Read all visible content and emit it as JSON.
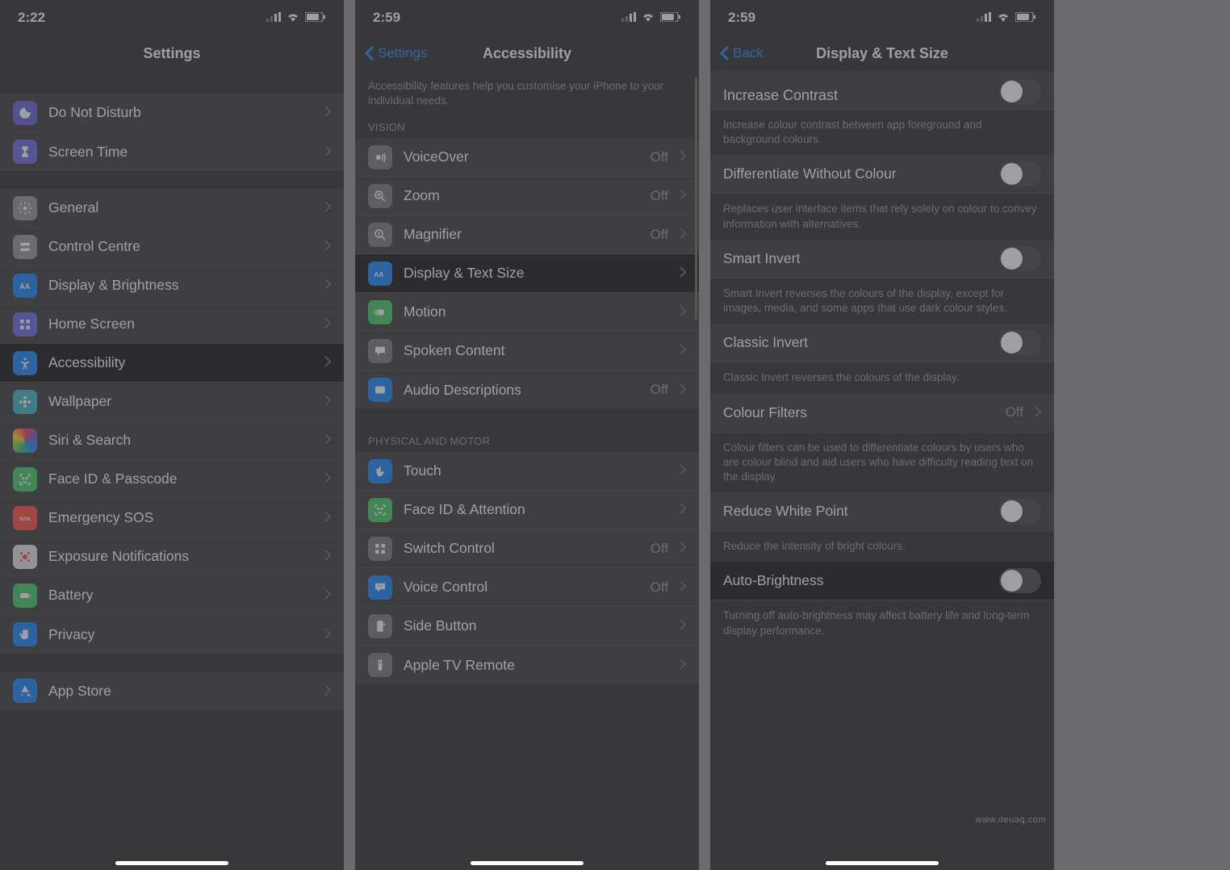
{
  "screen1": {
    "time": "2:22",
    "title": "Settings",
    "rows_group1": [
      {
        "id": "dnd",
        "label": "Do Not Disturb",
        "icon": "moon",
        "color": "ic-purple"
      },
      {
        "id": "screentime",
        "label": "Screen Time",
        "icon": "hourglass",
        "color": "ic-indigo"
      }
    ],
    "rows_group2": [
      {
        "id": "general",
        "label": "General",
        "icon": "gear",
        "color": "ic-gray"
      },
      {
        "id": "controlcentre",
        "label": "Control Centre",
        "icon": "switches",
        "color": "ic-gray"
      },
      {
        "id": "display",
        "label": "Display & Brightness",
        "icon": "textsize",
        "color": "ic-blue"
      },
      {
        "id": "homescreen",
        "label": "Home Screen",
        "icon": "grid",
        "color": "ic-indigo"
      },
      {
        "id": "accessibility",
        "label": "Accessibility",
        "icon": "accessibility",
        "color": "ic-blue",
        "highlight": true
      },
      {
        "id": "wallpaper",
        "label": "Wallpaper",
        "icon": "flower",
        "color": "ic-teal"
      },
      {
        "id": "siri",
        "label": "Siri & Search",
        "icon": "siri",
        "color": "gradient-siri"
      },
      {
        "id": "faceid",
        "label": "Face ID & Passcode",
        "icon": "faceid",
        "color": "ic-green"
      },
      {
        "id": "sos",
        "label": "Emergency SOS",
        "icon": "sos",
        "color": "ic-red"
      },
      {
        "id": "exposure",
        "label": "Exposure Notifications",
        "icon": "exposure",
        "color": "ic-white"
      },
      {
        "id": "battery",
        "label": "Battery",
        "icon": "battery",
        "color": "ic-green"
      },
      {
        "id": "privacy",
        "label": "Privacy",
        "icon": "hand",
        "color": "ic-blue"
      }
    ],
    "rows_group3": [
      {
        "id": "appstore",
        "label": "App Store",
        "icon": "appstore",
        "color": "ic-blue"
      }
    ]
  },
  "screen2": {
    "time": "2:59",
    "back": "Settings",
    "title": "Accessibility",
    "intro": "Accessibility features help you customise your iPhone to your individual needs.",
    "vision_header": "VISION",
    "vision_rows": [
      {
        "id": "voiceover",
        "label": "VoiceOver",
        "value": "Off",
        "icon": "voiceover",
        "color": "ic-dim"
      },
      {
        "id": "zoom",
        "label": "Zoom",
        "value": "Off",
        "icon": "zoom",
        "color": "ic-dim"
      },
      {
        "id": "magnifier",
        "label": "Magnifier",
        "value": "Off",
        "icon": "magnifier",
        "color": "ic-dim"
      },
      {
        "id": "textsize",
        "label": "Display & Text Size",
        "icon": "textsize",
        "color": "ic-blue",
        "highlight": true
      },
      {
        "id": "motion",
        "label": "Motion",
        "icon": "motion",
        "color": "ic-green"
      },
      {
        "id": "spoken",
        "label": "Spoken Content",
        "icon": "spoken",
        "color": "ic-dim"
      },
      {
        "id": "audiodesc",
        "label": "Audio Descriptions",
        "value": "Off",
        "icon": "audiodesc",
        "color": "ic-blue"
      }
    ],
    "motor_header": "PHYSICAL AND MOTOR",
    "motor_rows": [
      {
        "id": "touch",
        "label": "Touch",
        "icon": "touch",
        "color": "ic-blue"
      },
      {
        "id": "faceatt",
        "label": "Face ID & Attention",
        "icon": "faceid",
        "color": "ic-green"
      },
      {
        "id": "switch",
        "label": "Switch Control",
        "value": "Off",
        "icon": "switch",
        "color": "ic-dim"
      },
      {
        "id": "voicectl",
        "label": "Voice Control",
        "value": "Off",
        "icon": "voicectl",
        "color": "ic-blue"
      },
      {
        "id": "sidebutton",
        "label": "Side Button",
        "icon": "sidebutton",
        "color": "ic-dim"
      },
      {
        "id": "appletv",
        "label": "Apple TV Remote",
        "icon": "appletv",
        "color": "ic-dim"
      }
    ]
  },
  "screen3": {
    "time": "2:59",
    "back": "Back",
    "title": "Display & Text Size",
    "rows": [
      {
        "id": "increasecontrast",
        "label": "Increase Contrast",
        "toggle": false,
        "clipped": true,
        "foot": "Increase colour contrast between app foreground and background colours."
      },
      {
        "id": "diffcolour",
        "label": "Differentiate Without Colour",
        "toggle": false,
        "foot": "Replaces user interface items that rely solely on colour to convey information with alternatives."
      },
      {
        "id": "smartinvert",
        "label": "Smart Invert",
        "toggle": false,
        "foot": "Smart Invert reverses the colours of the display, except for images, media, and some apps that use dark colour styles."
      },
      {
        "id": "classicinvert",
        "label": "Classic Invert",
        "toggle": false,
        "foot": "Classic Invert reverses the colours of the display."
      },
      {
        "id": "colourfilters",
        "label": "Colour Filters",
        "value": "Off",
        "chevron": true,
        "foot": "Colour filters can be used to differentiate colours by users who are colour blind and aid users who have difficulty reading text on the display."
      },
      {
        "id": "reducewhite",
        "label": "Reduce White Point",
        "toggle": false,
        "foot": "Reduce the intensity of bright colours."
      },
      {
        "id": "autobrightness",
        "label": "Auto-Brightness",
        "toggle": false,
        "highlight": true,
        "foot": "Turning off auto-brightness may affect battery life and long-term display performance."
      }
    ],
    "watermark": "www.deuaq.com"
  }
}
